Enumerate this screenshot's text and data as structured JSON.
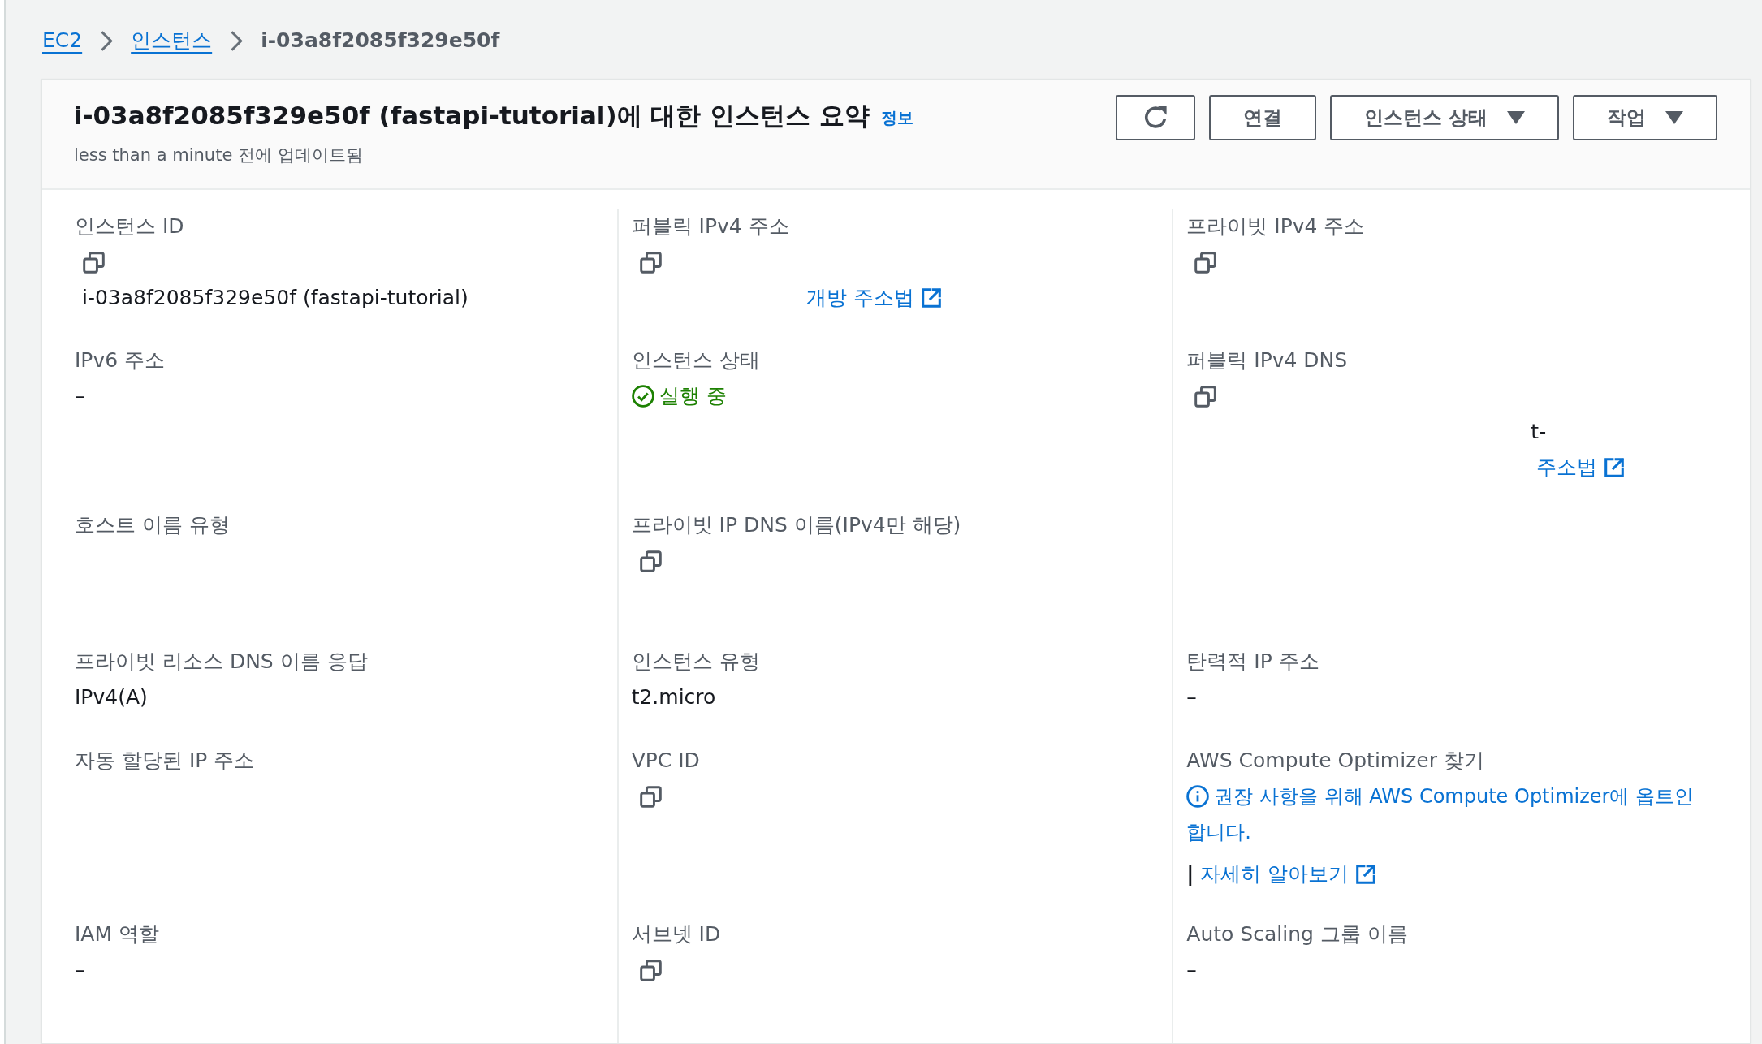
{
  "breadcrumb": [
    {
      "label": "EC2",
      "kind": "link"
    },
    {
      "label": "인스턴스",
      "kind": "link"
    },
    {
      "label": "i-03a8f2085f329e50f",
      "kind": "current"
    }
  ],
  "summary": {
    "title": "i-03a8f2085f329e50f (fastapi-tutorial)에 대한 인스턴스 요약",
    "info_link": "정보",
    "updated": "less than a minute 전에 업데이트됨",
    "buttons": [
      {
        "kind": "refresh"
      },
      {
        "kind": "plain",
        "label": "연결"
      },
      {
        "kind": "dropdown",
        "label": "인스턴스 상태"
      },
      {
        "kind": "dropdown",
        "label": "작업"
      }
    ]
  },
  "details": [
    [
      {
        "label": "인스턴스 ID",
        "lines": [
          {
            "kind": "copy"
          },
          {
            "kind": "copy_value",
            "text": "i-03a8f2085f329e50f (fastapi-tutorial)"
          }
        ]
      },
      {
        "label": "퍼블릭 IPv4 주소",
        "lines": [
          {
            "kind": "copy"
          },
          {
            "kind": "external_link",
            "text": "개방 주소법"
          }
        ]
      },
      {
        "label": "프라이빗 IPv4 주소",
        "lines": [
          {
            "kind": "copy"
          }
        ]
      }
    ],
    [
      {
        "label": "IPv6 주소",
        "lines": [
          {
            "kind": "text",
            "text": "–"
          }
        ]
      },
      {
        "label": "인스턴스 상태",
        "lines": [
          {
            "kind": "status_success",
            "text": "실행 중"
          }
        ]
      },
      {
        "label": "퍼블릭 IPv4 DNS",
        "lines": [
          {
            "kind": "copy"
          },
          {
            "kind": "text",
            "text": "t-"
          },
          {
            "kind": "external_link",
            "text": "주소법"
          }
        ]
      }
    ],
    [
      {
        "label": "호스트 이름 유형"
      },
      {
        "label": "프라이빗 IP DNS 이름(IPv4만 해당)",
        "lines": [
          {
            "kind": "copy"
          }
        ]
      }
    ],
    [
      {
        "label": "프라이빗 리소스 DNS 이름 응답",
        "lines": [
          {
            "kind": "text",
            "text": "IPv4(A)"
          }
        ]
      },
      {
        "label": "인스턴스 유형",
        "lines": [
          {
            "kind": "text",
            "text": "t2.micro"
          }
        ]
      },
      {
        "label": "탄력적 IP 주소",
        "lines": [
          {
            "kind": "text",
            "text": "–"
          }
        ]
      }
    ],
    [
      {
        "label": "자동 할당된 IP 주소"
      },
      {
        "label": "VPC ID",
        "lines": [
          {
            "kind": "copy"
          }
        ]
      },
      {
        "label": "AWS Compute Optimizer 찾기",
        "lines": [
          {
            "kind": "info",
            "text": "권장 사항을 위해 AWS Compute Optimizer에 옵트인 합니다."
          },
          {
            "kind": "learn_more",
            "separator": "|",
            "text": "자세히 알아보기"
          }
        ]
      }
    ],
    [
      {
        "label": "IAM 역할",
        "lines": [
          {
            "kind": "text",
            "text": "–"
          }
        ]
      },
      {
        "label": "서브넷 ID",
        "lines": [
          {
            "kind": "copy"
          }
        ]
      },
      {
        "label": "Auto Scaling 그룹 이름",
        "lines": [
          {
            "kind": "text",
            "text": "–"
          }
        ]
      }
    ]
  ]
}
